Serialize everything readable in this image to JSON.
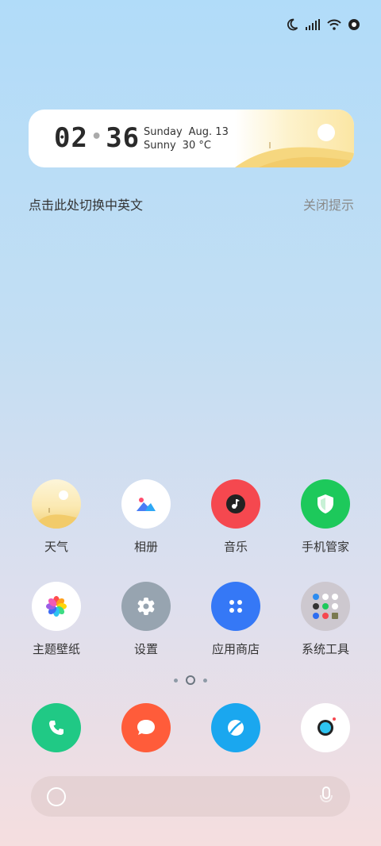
{
  "statusbar": {
    "icons": [
      "moon-icon",
      "signal-icon",
      "wifi-icon",
      "record-icon"
    ]
  },
  "widget": {
    "hour": "02",
    "minute": "36",
    "weekday": "Sunday",
    "date": "Aug. 13",
    "weather": "Sunny",
    "temperature": "30 °C"
  },
  "tips": {
    "switch_text": "点击此处切换中英文",
    "close_text": "关闭提示"
  },
  "apps_row1": [
    {
      "label": "天气",
      "icon": "weather-icon"
    },
    {
      "label": "相册",
      "icon": "gallery-icon"
    },
    {
      "label": "音乐",
      "icon": "music-icon"
    },
    {
      "label": "手机管家",
      "icon": "phone-manager-icon"
    }
  ],
  "apps_row2": [
    {
      "label": "主题壁纸",
      "icon": "theme-icon"
    },
    {
      "label": "设置",
      "icon": "settings-icon"
    },
    {
      "label": "应用商店",
      "icon": "app-store-icon"
    },
    {
      "label": "系统工具",
      "icon": "system-tools-folder-icon"
    }
  ],
  "page_indicator": {
    "pages": 3,
    "current": 2
  },
  "dock": [
    "phone-icon",
    "messages-icon",
    "browser-icon",
    "camera-icon"
  ],
  "colors": {
    "music": "#f5484f",
    "manager": "#1dc95b",
    "store": "#3578f6",
    "settings": "#97a4b0",
    "phone": "#20c985",
    "messages": "#ff5c3a",
    "browser": "#1aa7ef"
  }
}
